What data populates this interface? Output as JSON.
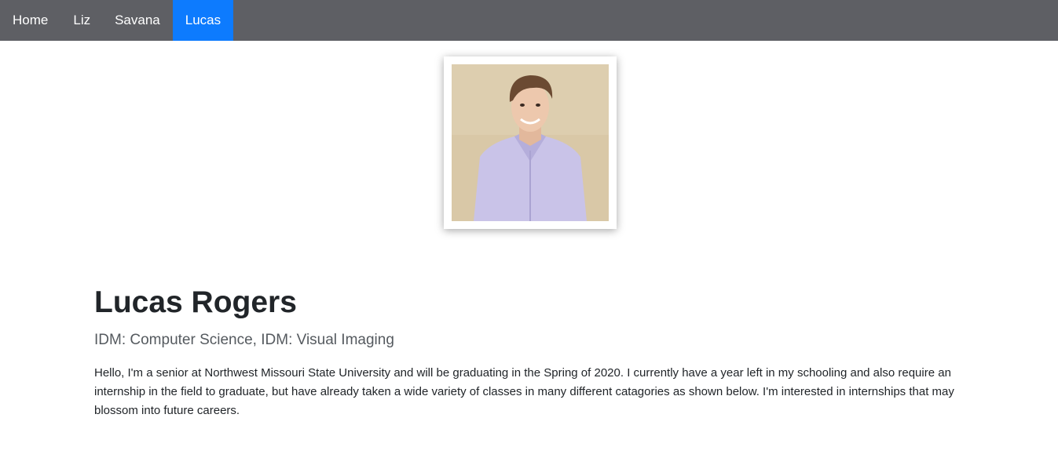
{
  "nav": {
    "items": [
      {
        "label": "Home",
        "active": false
      },
      {
        "label": "Liz",
        "active": false
      },
      {
        "label": "Savana",
        "active": false
      },
      {
        "label": "Lucas",
        "active": true
      }
    ]
  },
  "profile": {
    "photo_icon": "portrait-photo",
    "name": "Lucas Rogers",
    "subtitle": "IDM: Computer Science, IDM: Visual Imaging",
    "bio": "Hello, I'm a senior at Northwest Missouri State University and will be graduating in the Spring of 2020. I currently have a year left in my schooling and also require an internship in the field to graduate, but have already taken a wide variety of classes in many different catagories as shown below. I'm interested in internships that may blossom into future careers."
  },
  "colors": {
    "navbar": "#5e5f64",
    "active": "#0d7bfe"
  }
}
